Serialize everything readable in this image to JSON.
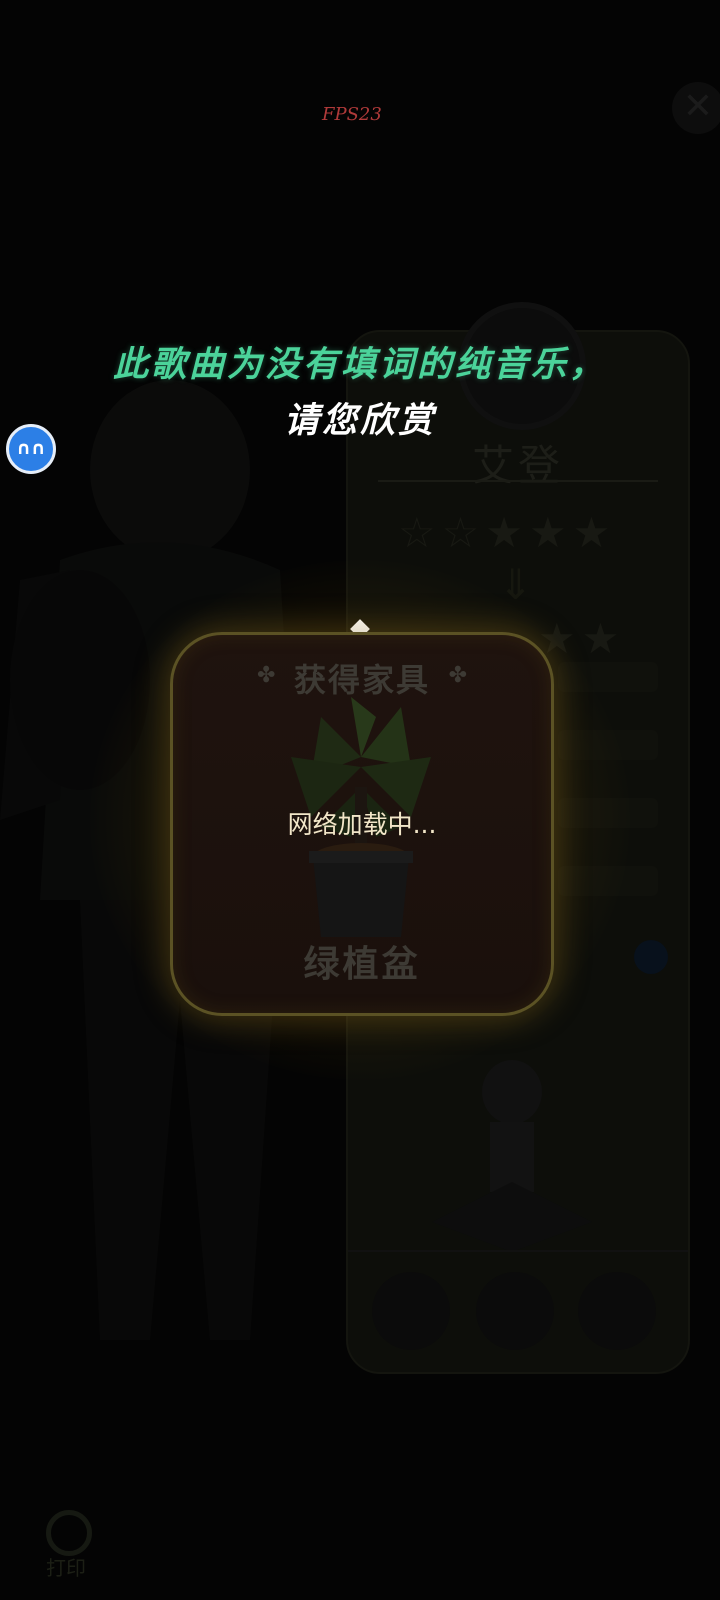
{
  "overlay": {
    "fps_label": "FPS23",
    "lyric_line1": "此歌曲为没有填词的纯音乐，",
    "lyric_line2": "请您欣赏",
    "float_bubble_icon": "chat-bubble-icon",
    "search_label": "打印"
  },
  "reward_card": {
    "title": "获得家具",
    "loading_text": "网络加载中...",
    "item_name": "绿植盆",
    "item_icon": "potted-plant-icon"
  },
  "background_panel": {
    "character_name": "艾登",
    "close_icon": "close-icon"
  },
  "colors": {
    "lyric_accent": "#4bd39a",
    "card_border": "#5b5224",
    "fps_text": "#b03a3a"
  }
}
